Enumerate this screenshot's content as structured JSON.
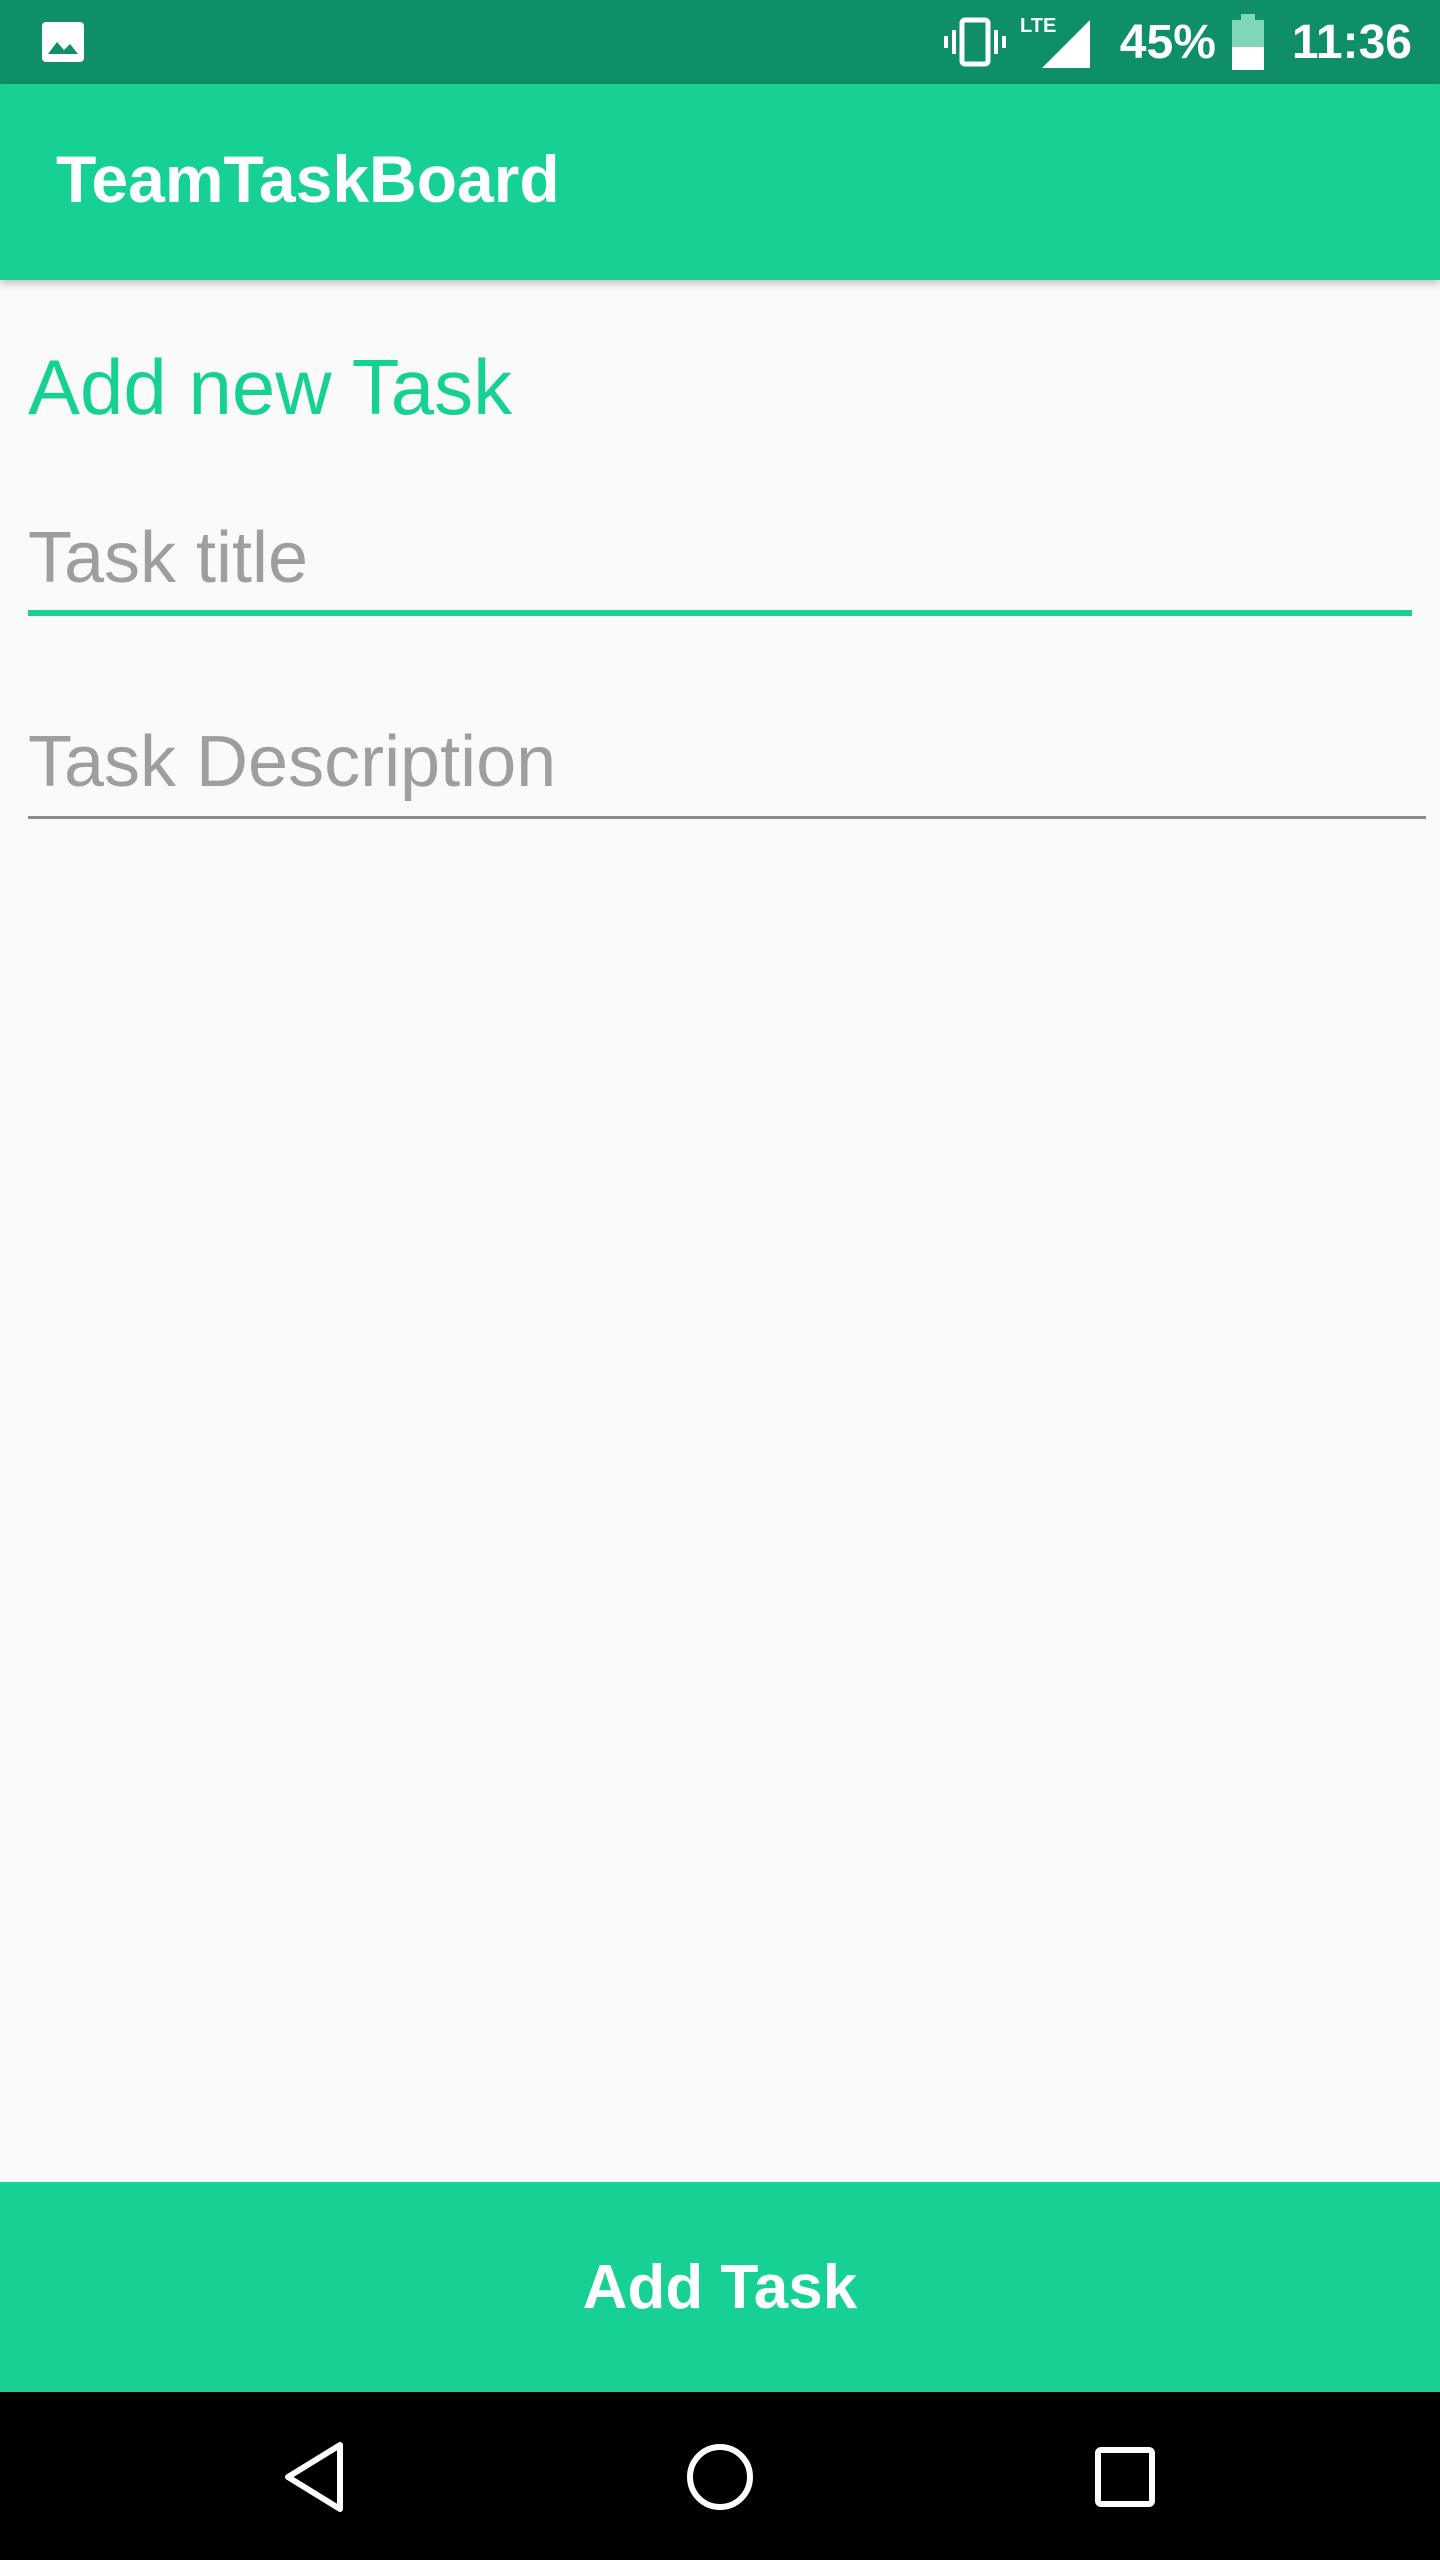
{
  "status_bar": {
    "left_icon": "image-icon",
    "vibrate_icon": "vibrate-icon",
    "network_icon": "lte-signal-icon",
    "network_label": "LTE",
    "battery_percent": "45%",
    "battery_level": 0.45,
    "time": "11:36",
    "background_color": "#0e8f67"
  },
  "app_bar": {
    "title": "TeamTaskBoard",
    "background_color": "#17d094"
  },
  "form": {
    "heading": "Add new Task",
    "title_field": {
      "placeholder": "Task title",
      "value": ""
    },
    "description_field": {
      "placeholder": "Task Description",
      "value": ""
    }
  },
  "actions": {
    "add_task_label": "Add Task"
  },
  "nav_bar": {
    "back_icon": "back-triangle-icon",
    "home_icon": "home-circle-icon",
    "recents_icon": "recents-square-icon"
  },
  "colors": {
    "accent": "#17d094",
    "status_bar": "#0e8f67",
    "background": "#fafafa",
    "placeholder": "#9e9e9e"
  }
}
